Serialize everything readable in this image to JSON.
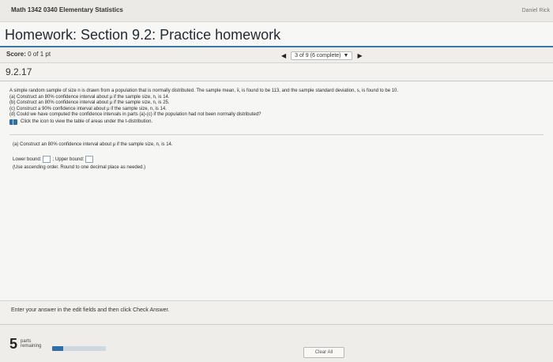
{
  "app": {
    "course_title": "Math 1342 0340 Elementary Statistics",
    "user_name": "Daniel Rick"
  },
  "header": {
    "title": "Homework: Section 9.2: Practice homework"
  },
  "score": {
    "label": "Score:",
    "value": "0 of 1 pt"
  },
  "navigation": {
    "prev_arrow": "◀",
    "progress_text": "3 of 9 (6 complete)",
    "dropdown_caret": "▼",
    "next_arrow": "▶"
  },
  "question": {
    "number": "9.2.17",
    "lines": [
      "A simple random sample of size n is drawn from a population that is normally distributed. The sample mean, x̄, is found to be 113, and the sample standard deviation, s, is found to be 10.",
      "(a) Construct an 80% confidence interval about μ if the sample size, n, is 14.",
      "(b) Construct an 80% confidence interval about μ if the sample size, n, is 25.",
      "(c) Construct a 90% confidence interval about μ if the sample size, n, is 14.",
      "(d) Could we have computed the confidence intervals in parts (a)-(c) if the population had not been normally distributed?"
    ],
    "help_text": "Click the icon to view the table of areas under the t-distribution.",
    "part_a": "(a) Construct an 80% confidence interval about μ if the sample size, n, is 14.",
    "lower_bound_label": "Lower bound:",
    "separator": ";",
    "upper_bound_label": "Upper bound:",
    "hint": "(Use ascending order. Round to one decimal place as needed.)"
  },
  "instruction": "Enter your answer in the edit fields and then click Check Answer.",
  "footer": {
    "parts_count": "5",
    "parts_label_1": "parts",
    "parts_label_2": "remaining",
    "parts_progress": 0.2,
    "clear_all_label": "Clear All"
  },
  "colors": {
    "accent": "#3c7aa8",
    "progress_fill": "#2f6fa7"
  },
  "icons": {
    "help": "book-icon"
  }
}
